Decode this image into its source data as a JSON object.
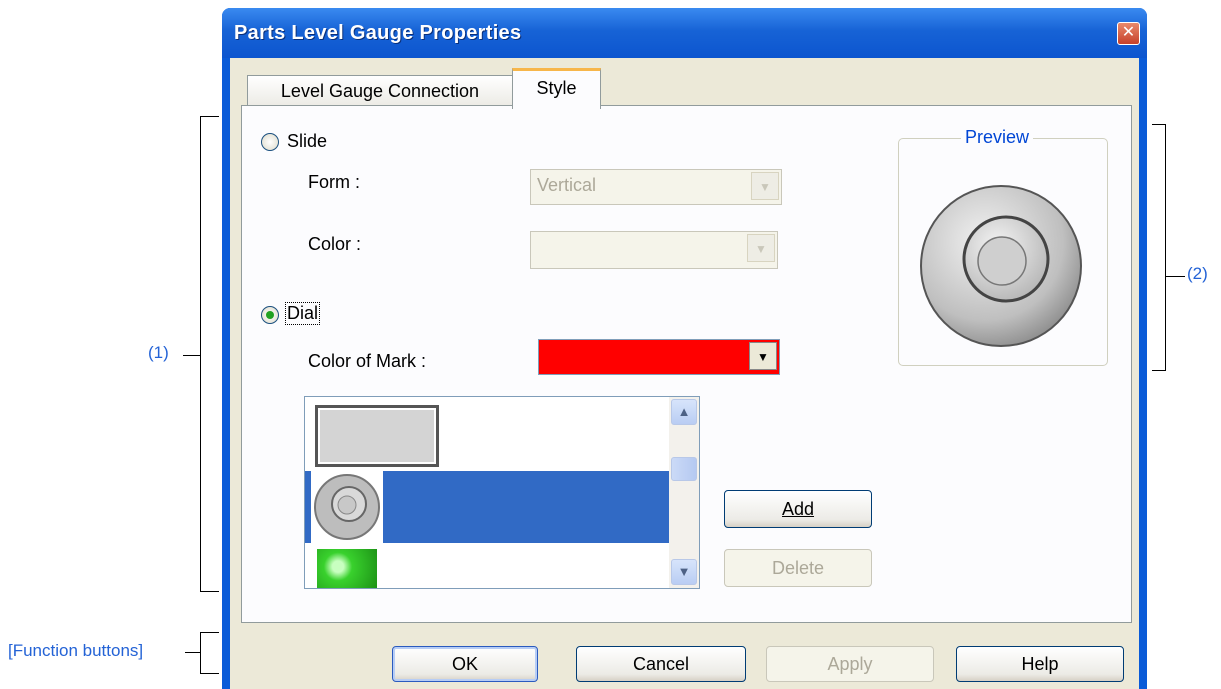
{
  "window": {
    "title": "Parts Level Gauge Properties"
  },
  "tabs": [
    {
      "label": "Level Gauge Connection"
    },
    {
      "label": "Style"
    }
  ],
  "slide": {
    "label": "Slide",
    "form_label": "Form :",
    "form_value": "Vertical",
    "color_label": "Color :",
    "color_value": ""
  },
  "dial": {
    "label": "Dial",
    "color_of_mark_label": "Color of Mark :",
    "mark_color": "#ff0000",
    "selected": true
  },
  "style_list": {
    "items": [
      "frame-rect",
      "dial-knob",
      "green-gauge"
    ],
    "selected_index": 1
  },
  "buttons": {
    "add": "Add",
    "delete": "Delete"
  },
  "preview": {
    "title": "Preview"
  },
  "function_buttons": {
    "ok": "OK",
    "cancel": "Cancel",
    "apply": "Apply",
    "help": "Help"
  },
  "annotations": {
    "area1": "(1)",
    "area2": "(2)",
    "function": "[Function buttons]"
  },
  "colors": {
    "title_bar": "#0a5bd8",
    "selection": "#316ac5",
    "annotation": "#2463d6"
  }
}
